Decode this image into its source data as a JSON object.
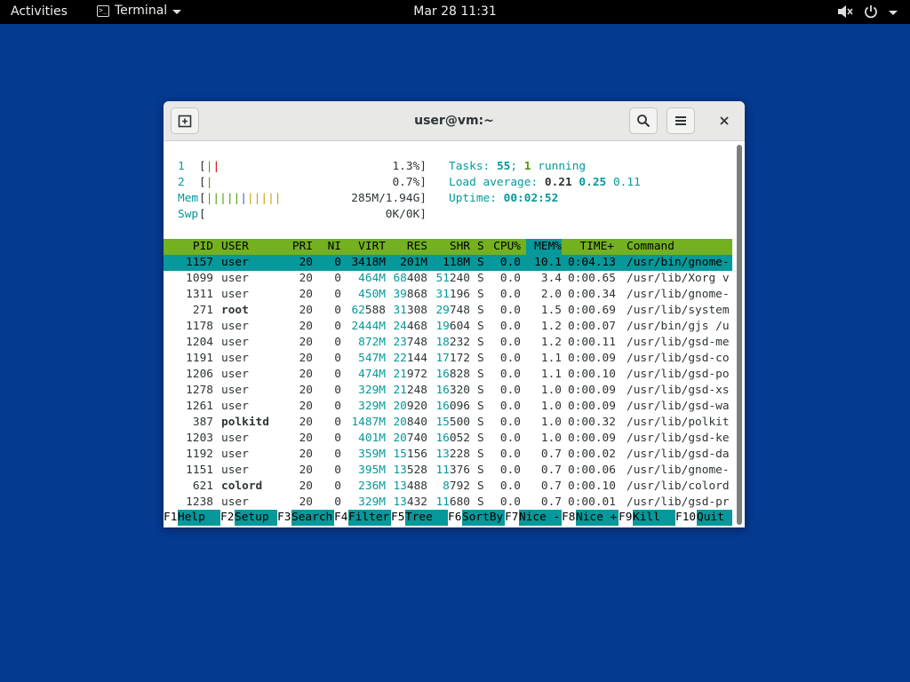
{
  "topbar": {
    "activities": "Activities",
    "app_name": "Terminal",
    "clock": "Mar 28  11:31"
  },
  "window": {
    "title": "user@vm:~"
  },
  "htop": {
    "cpu1": {
      "label": "1",
      "value": "1.3%]"
    },
    "cpu2": {
      "label": "2",
      "value": "0.7%]"
    },
    "mem": {
      "label": "Mem",
      "value": "285M/1.94G]"
    },
    "swp": {
      "label": "Swp",
      "value": "0K/0K]"
    },
    "tasks_label": "Tasks: ",
    "tasks_count": "55",
    "tasks_sep": "; ",
    "tasks_running": "1",
    "tasks_running_label": " running",
    "load_label": "Load average: ",
    "load_1": "0.21",
    "load_5": "0.25",
    "load_15": "0.11",
    "uptime_label": "Uptime: ",
    "uptime": "00:02:52",
    "columns": {
      "pid": "PID",
      "user": "USER",
      "pri": "PRI",
      "ni": "NI",
      "virt": "VIRT",
      "res": "RES",
      "shr": "SHR",
      "s": "S",
      "cpu": "CPU%",
      "mem": "MEM%",
      "time": "TIME+",
      "command": "Command"
    },
    "processes": [
      {
        "pid": "1157",
        "user": "user",
        "pri": "20",
        "ni": "0",
        "virt": "3418M",
        "res": "201M",
        "shr": "118M",
        "s": "S",
        "cpu": "0.0",
        "mem": "10.1",
        "time": "0:04.13",
        "command": "/usr/bin/gnome-"
      },
      {
        "pid": "1099",
        "user": "user",
        "pri": "20",
        "ni": "0",
        "virt": "464M",
        "res": "68408",
        "shr": "51240",
        "s": "S",
        "cpu": "0.0",
        "mem": "3.4",
        "time": "0:00.65",
        "command": "/usr/lib/Xorg v"
      },
      {
        "pid": "1311",
        "user": "user",
        "pri": "20",
        "ni": "0",
        "virt": "450M",
        "res": "39868",
        "shr": "31196",
        "s": "S",
        "cpu": "0.0",
        "mem": "2.0",
        "time": "0:00.34",
        "command": "/usr/lib/gnome-"
      },
      {
        "pid": "271",
        "user": "root",
        "pri": "20",
        "ni": "0",
        "virt": "62588",
        "res": "31308",
        "shr": "29748",
        "s": "S",
        "cpu": "0.0",
        "mem": "1.5",
        "time": "0:00.69",
        "command": "/usr/lib/system"
      },
      {
        "pid": "1178",
        "user": "user",
        "pri": "20",
        "ni": "0",
        "virt": "2444M",
        "res": "24468",
        "shr": "19604",
        "s": "S",
        "cpu": "0.0",
        "mem": "1.2",
        "time": "0:00.07",
        "command": "/usr/bin/gjs /u"
      },
      {
        "pid": "1204",
        "user": "user",
        "pri": "20",
        "ni": "0",
        "virt": "872M",
        "res": "23748",
        "shr": "18232",
        "s": "S",
        "cpu": "0.0",
        "mem": "1.2",
        "time": "0:00.11",
        "command": "/usr/lib/gsd-me"
      },
      {
        "pid": "1191",
        "user": "user",
        "pri": "20",
        "ni": "0",
        "virt": "547M",
        "res": "22144",
        "shr": "17172",
        "s": "S",
        "cpu": "0.0",
        "mem": "1.1",
        "time": "0:00.09",
        "command": "/usr/lib/gsd-co"
      },
      {
        "pid": "1206",
        "user": "user",
        "pri": "20",
        "ni": "0",
        "virt": "474M",
        "res": "21972",
        "shr": "16828",
        "s": "S",
        "cpu": "0.0",
        "mem": "1.1",
        "time": "0:00.10",
        "command": "/usr/lib/gsd-po"
      },
      {
        "pid": "1278",
        "user": "user",
        "pri": "20",
        "ni": "0",
        "virt": "329M",
        "res": "21248",
        "shr": "16320",
        "s": "S",
        "cpu": "0.0",
        "mem": "1.0",
        "time": "0:00.09",
        "command": "/usr/lib/gsd-xs"
      },
      {
        "pid": "1261",
        "user": "user",
        "pri": "20",
        "ni": "0",
        "virt": "329M",
        "res": "20920",
        "shr": "16096",
        "s": "S",
        "cpu": "0.0",
        "mem": "1.0",
        "time": "0:00.09",
        "command": "/usr/lib/gsd-wa"
      },
      {
        "pid": "387",
        "user": "polkitd",
        "pri": "20",
        "ni": "0",
        "virt": "1487M",
        "res": "20840",
        "shr": "15500",
        "s": "S",
        "cpu": "0.0",
        "mem": "1.0",
        "time": "0:00.32",
        "command": "/usr/lib/polkit"
      },
      {
        "pid": "1203",
        "user": "user",
        "pri": "20",
        "ni": "0",
        "virt": "401M",
        "res": "20740",
        "shr": "16052",
        "s": "S",
        "cpu": "0.0",
        "mem": "1.0",
        "time": "0:00.09",
        "command": "/usr/lib/gsd-ke"
      },
      {
        "pid": "1192",
        "user": "user",
        "pri": "20",
        "ni": "0",
        "virt": "359M",
        "res": "15156",
        "shr": "13228",
        "s": "S",
        "cpu": "0.0",
        "mem": "0.7",
        "time": "0:00.02",
        "command": "/usr/lib/gsd-da"
      },
      {
        "pid": "1151",
        "user": "user",
        "pri": "20",
        "ni": "0",
        "virt": "395M",
        "res": "13528",
        "shr": "11376",
        "s": "S",
        "cpu": "0.0",
        "mem": "0.7",
        "time": "0:00.06",
        "command": "/usr/lib/gnome-"
      },
      {
        "pid": "621",
        "user": "colord",
        "pri": "20",
        "ni": "0",
        "virt": "236M",
        "res": "13488",
        "shr": "8792",
        "s": "S",
        "cpu": "0.0",
        "mem": "0.7",
        "time": "0:00.10",
        "command": "/usr/lib/colord"
      },
      {
        "pid": "1238",
        "user": "user",
        "pri": "20",
        "ni": "0",
        "virt": "329M",
        "res": "13432",
        "shr": "11680",
        "s": "S",
        "cpu": "0.0",
        "mem": "0.7",
        "time": "0:00.01",
        "command": "/usr/lib/gsd-pr"
      }
    ],
    "fkeys": [
      {
        "key": "F1",
        "label": "Help  "
      },
      {
        "key": "F2",
        "label": "Setup "
      },
      {
        "key": "F3",
        "label": "Search"
      },
      {
        "key": "F4",
        "label": "Filter"
      },
      {
        "key": "F5",
        "label": "Tree  "
      },
      {
        "key": "F6",
        "label": "SortBy"
      },
      {
        "key": "F7",
        "label": "Nice -"
      },
      {
        "key": "F8",
        "label": "Nice +"
      },
      {
        "key": "F9",
        "label": "Kill  "
      },
      {
        "key": "F10",
        "label": "Quit  "
      }
    ]
  }
}
